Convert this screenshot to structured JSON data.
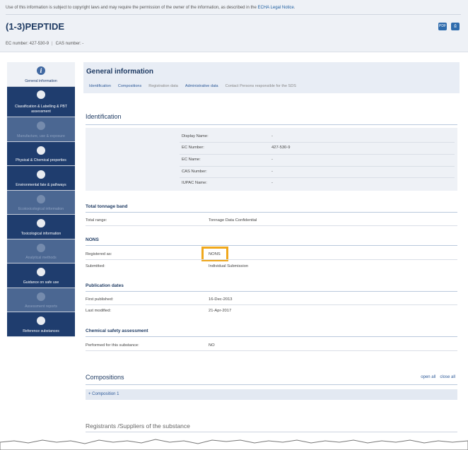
{
  "legal": {
    "text": "Use of this information is subject to copyright laws and may require the permission of the owner of the information, as described in the",
    "link": "ECHA Legal Notice",
    "end": "."
  },
  "substance": {
    "title": "(1-3)PEPTIDE",
    "ec_number": "EC number: 427-530-9",
    "cas_number": "CAS number: -"
  },
  "toolbar": {
    "pdf_icon_label": "PDF"
  },
  "sidebar": {
    "items": [
      {
        "label": "General information",
        "icon": "info-icon",
        "icon_glyph": "i",
        "state": "active"
      },
      {
        "label": "Classification & Labelling & PBT assessment",
        "icon": "classification-icon",
        "state": "enabled"
      },
      {
        "label": "Manufacture, use & exposure",
        "icon": "factory-icon",
        "state": "disabled"
      },
      {
        "label": "Physical & Chemical properties",
        "icon": "flask-icon",
        "state": "enabled"
      },
      {
        "label": "Environmental fate & pathways",
        "icon": "leaf-icon",
        "state": "enabled"
      },
      {
        "label": "Ecotoxicological information",
        "icon": "fish-icon",
        "state": "disabled"
      },
      {
        "label": "Toxicological information",
        "icon": "warning-icon",
        "state": "enabled"
      },
      {
        "label": "Analytical methods",
        "icon": "document-icon",
        "state": "disabled"
      },
      {
        "label": "Guidance on safe use",
        "icon": "bookmark-icon",
        "state": "enabled"
      },
      {
        "label": "Assessment reports",
        "icon": "checklist-icon",
        "state": "disabled"
      },
      {
        "label": "Reference substances",
        "icon": "beaker-icon",
        "state": "enabled"
      }
    ]
  },
  "general_info": {
    "title": "General information",
    "tabs": [
      {
        "label": "Identification",
        "state": "active"
      },
      {
        "label": "Compositions",
        "state": "active"
      },
      {
        "label": "Registration data",
        "state": "muted"
      },
      {
        "label": "Administrative data",
        "state": "active"
      },
      {
        "label": "Contact Persons responsible for the SDS",
        "state": "muted"
      }
    ]
  },
  "identification": {
    "title": "Identification",
    "rows": [
      {
        "label": "Display Name:",
        "value": "-"
      },
      {
        "label": "EC Number:",
        "value": "427-530-9"
      },
      {
        "label": "EC Name:",
        "value": "-"
      },
      {
        "label": "CAS Number:",
        "value": "-"
      },
      {
        "label": "IUPAC Name:",
        "value": "-"
      }
    ]
  },
  "tonnage": {
    "title": "Total tonnage band",
    "label": "Total range:",
    "value": "Tonnage Data Confidential"
  },
  "nons": {
    "title": "NONS",
    "registered_label": "Registered as:",
    "registered_value": "NONS",
    "submitted_label": "Submitted:",
    "submitted_value": "Individual Submission"
  },
  "publication": {
    "title": "Publication dates",
    "first_label": "First published:",
    "first_value": "16-Dec-2013",
    "last_label": "Last modified:",
    "last_value": "21-Apr-2017"
  },
  "csa": {
    "title": "Chemical safety assessment",
    "label": "Performed for this substance:",
    "value": "NO"
  },
  "compositions": {
    "title": "Compositions",
    "open_all": "open all",
    "close_all": "close all",
    "item": "+ Composition 1"
  },
  "registrants": {
    "title": "Registrants /Suppliers of the substance"
  },
  "colors": {
    "navy": "#1f3d6e",
    "accent": "#2f5b99",
    "highlight": "#f0a81c"
  }
}
